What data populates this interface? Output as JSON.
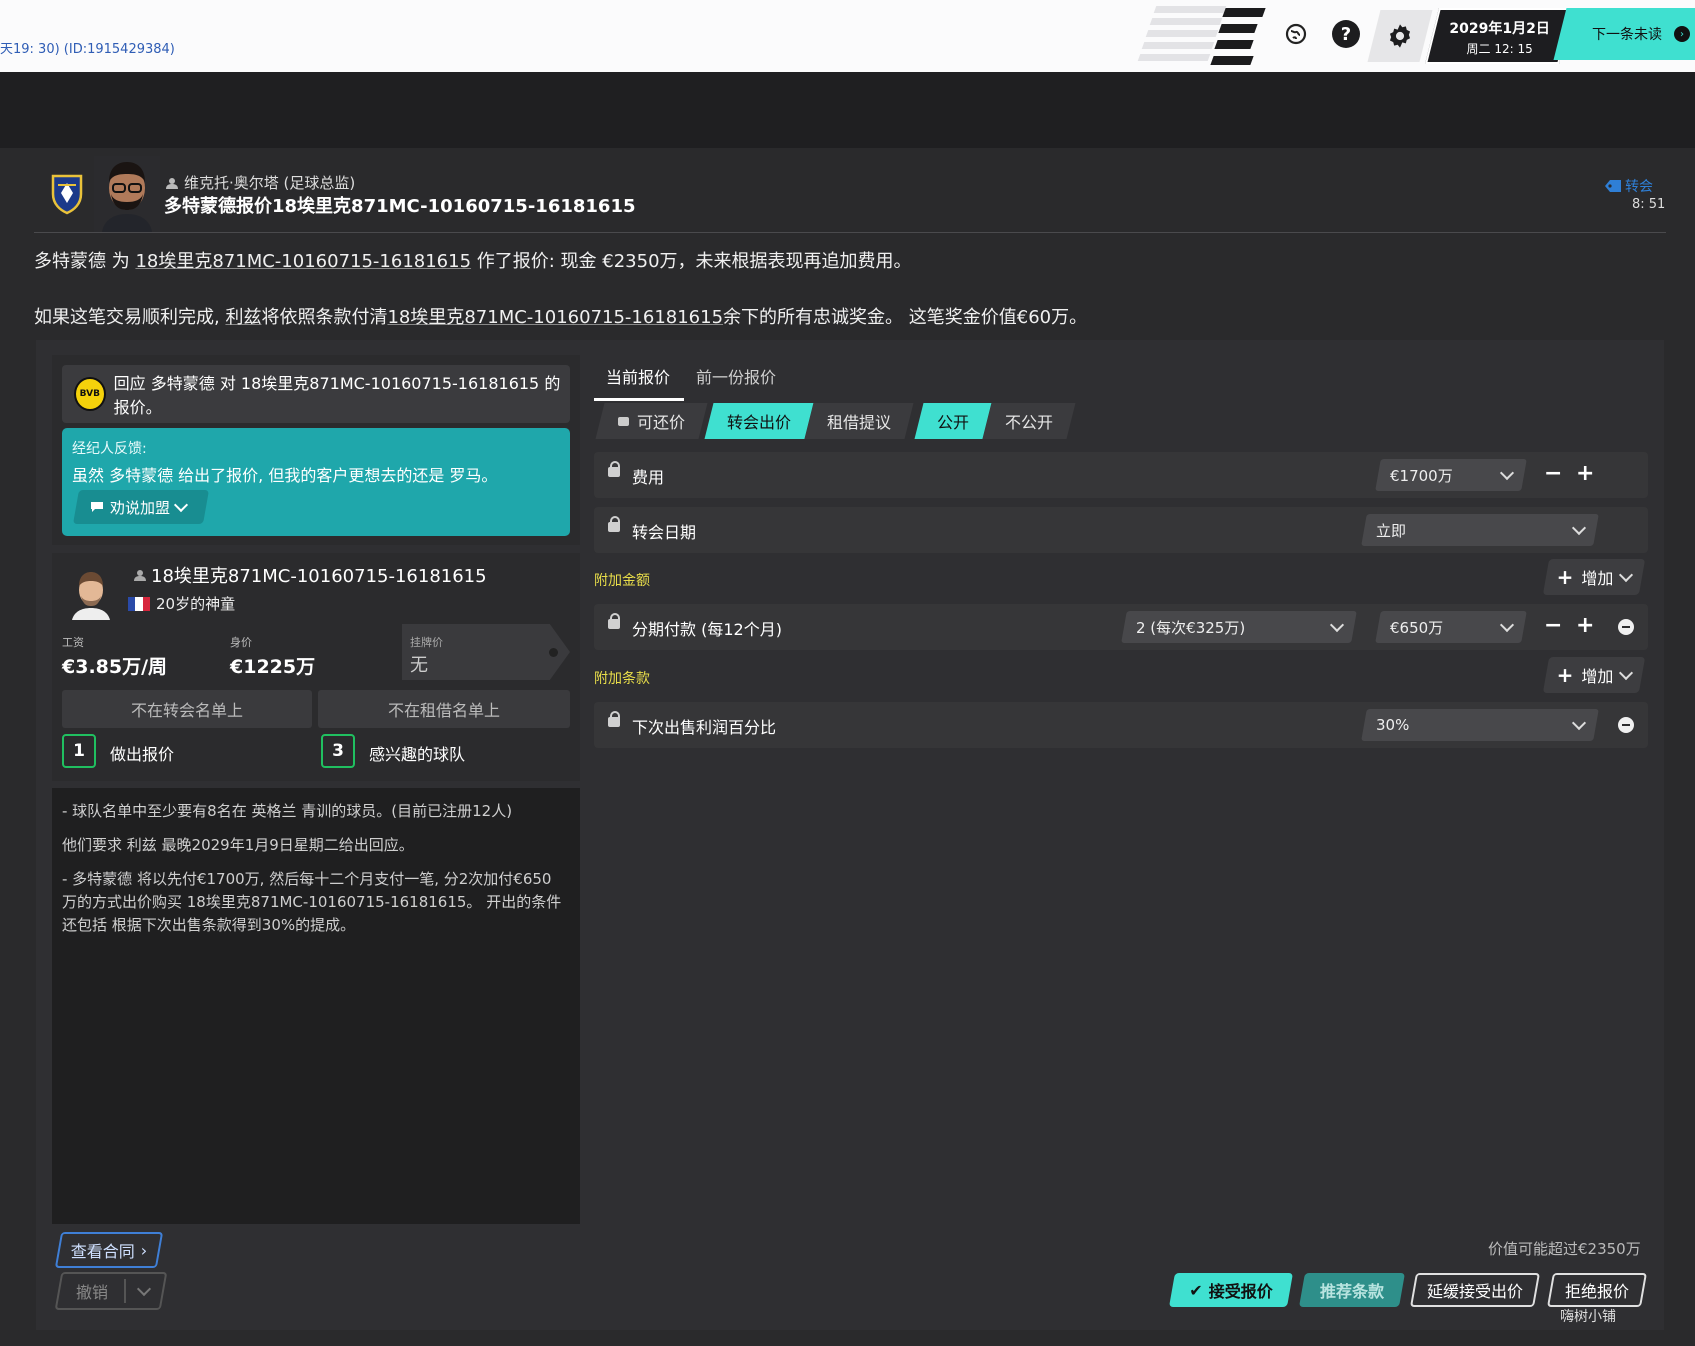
{
  "topbar": {
    "crumb": "天19: 30) (ID:1915429384)",
    "date": "2029年1月2日",
    "weekday_time": "周二 12: 15",
    "next_unread": "下一条未读",
    "icons": [
      "globe-icon",
      "help-icon",
      "settings-icon"
    ]
  },
  "message": {
    "sender": "维克托·奥尔塔 (足球总监)",
    "subject": "多特蒙德报价18埃里克871MC-10160715-16181615",
    "tag": "转会",
    "time": "8: 51",
    "para1_a": "多特蒙德 为 ",
    "para1_player": "18埃里克871MC-10160715-16181615",
    "para1_b": " 作了报价: 现金 €2350万，未来根据表现再追加费用。",
    "para2_a": "如果这笔交易顺利完成, ",
    "para2_club": "利兹",
    "para2_b": "将依照条款付清",
    "para2_player": "18埃里克871MC-10160715-16181615",
    "para2_c": "余下的所有忠诚奖金。 这笔奖金价值€60万。"
  },
  "left": {
    "respond_badge": "BVB",
    "respond_text": "回应 多特蒙德 对 18埃里克871MC-10160715-16181615 的报价。",
    "agent_title": "经纪人反馈:",
    "agent_text": "虽然 多特蒙德 给出了报价, 但我的客户更想去的还是 罗马。",
    "persuade_label": "劝说加盟",
    "player_name": "18埃里克871MC-10160715-16181615",
    "player_desc": "20岁的神童",
    "wage_label": "工资",
    "wage_value": "€3.85万/周",
    "value_label": "身价",
    "value_value": "€1225万",
    "asking_label": "挂牌价",
    "asking_value": "无",
    "not_transfer_list": "不在转会名单上",
    "not_loan_list": "不在租借名单上",
    "offers_count": "1",
    "offers_label": "做出报价",
    "interested_count": "3",
    "interested_label": "感兴趣的球队",
    "note1": "- 球队名单中至少要有8名在 英格兰 青训的球员。(目前已注册12人)",
    "note2": "他们要求 利兹 最晚2029年1月9日星期二给出回应。",
    "note3": "- 多特蒙德 将以先付€1700万, 然后每十二个月支付一笔, 分2次加付€650万的方式出价购买 18埃里克871MC-10160715-16181615。 开出的条件还包括 根据下次出售条款得到30%的提成。"
  },
  "right": {
    "tab_current": "当前报价",
    "tab_previous": "前一份报价",
    "toggle_negotiable": "可还价",
    "toggle_transfer": "转会出价",
    "toggle_loan": "租借提议",
    "toggle_public": "公开",
    "toggle_private": "不公开",
    "fee_label": "费用",
    "fee_value": "€1700万",
    "date_label": "转会日期",
    "date_value": "立即",
    "addons_label": "附加金额",
    "add_label": "增加",
    "installment_label": "分期付款 (每12个月)",
    "installment_count": "2 (每次€325万)",
    "installment_value": "€650万",
    "clauses_label": "附加条款",
    "sellon_label": "下次出售利润百分比",
    "sellon_value": "30%"
  },
  "bottom": {
    "view_contract": "查看合同",
    "undo": "撤销",
    "worth": "价值可能超过€2350万",
    "accept": "接受报价",
    "recommend": "推荐条款",
    "delay": "延缓接受出价",
    "reject": "拒绝报价",
    "watermark": "嗨树小铺"
  },
  "colors": {
    "accent": "#3fe0d0",
    "agent_bg": "#1fa7ab",
    "section_label": "#e9de4a",
    "count_border": "#20c060"
  }
}
